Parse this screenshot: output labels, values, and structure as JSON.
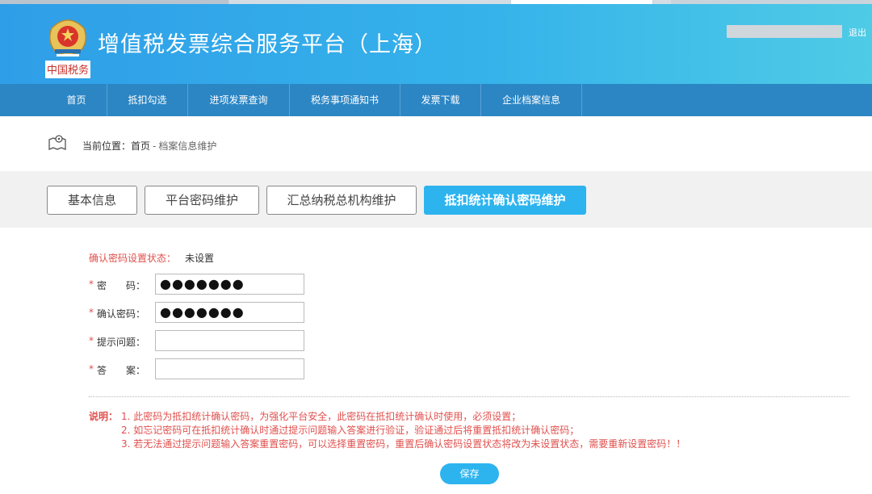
{
  "header": {
    "title": "增值税发票综合服务平台（上海）",
    "logo_text": "中国税务",
    "logout_label": "退出",
    "colors": {
      "header_start": "#2f9ee8",
      "header_end": "#4ecbe6",
      "nav": "#2c86c4",
      "accent": "#2db4ee",
      "required": "#e0504d"
    }
  },
  "nav": {
    "items": [
      "首页",
      "抵扣勾选",
      "进项发票查询",
      "税务事项通知书",
      "发票下载",
      "企业档案信息"
    ]
  },
  "breadcrumb": {
    "label": "当前位置：",
    "home": "首页",
    "separator": "-",
    "current": "档案信息维护",
    "icon": "location-map-icon"
  },
  "tabs": [
    {
      "label": "基本信息",
      "active": false
    },
    {
      "label": "平台密码维护",
      "active": false
    },
    {
      "label": "汇总纳税总机构维护",
      "active": false
    },
    {
      "label": "抵扣统计确认密码维护",
      "active": true
    }
  ],
  "form": {
    "status_label": "确认密码设置状态：",
    "status_value": "未设置",
    "required_mark": "*",
    "fields": [
      {
        "label": "密　　码：",
        "value": "●●●●●●●"
      },
      {
        "label": "确认密码：",
        "value": "●●●●●●●"
      },
      {
        "label": "提示问题：",
        "value": ""
      },
      {
        "label": "答　　案：",
        "value": ""
      }
    ]
  },
  "notes": {
    "title": "说明：",
    "items": [
      "1. 此密码为抵扣统计确认密码，为强化平台安全，此密码在抵扣统计确认时使用，必须设置；",
      "2. 如忘记密码可在抵扣统计确认时通过提示问题输入答案进行验证，验证通过后将重置抵扣统计确认密码；",
      "3. 若无法通过提示问题输入答案重置密码，可以选择重置密码，重置后确认密码设置状态将改为未设置状态，需要重新设置密码！！"
    ]
  },
  "actions": {
    "save_label": "保存"
  }
}
